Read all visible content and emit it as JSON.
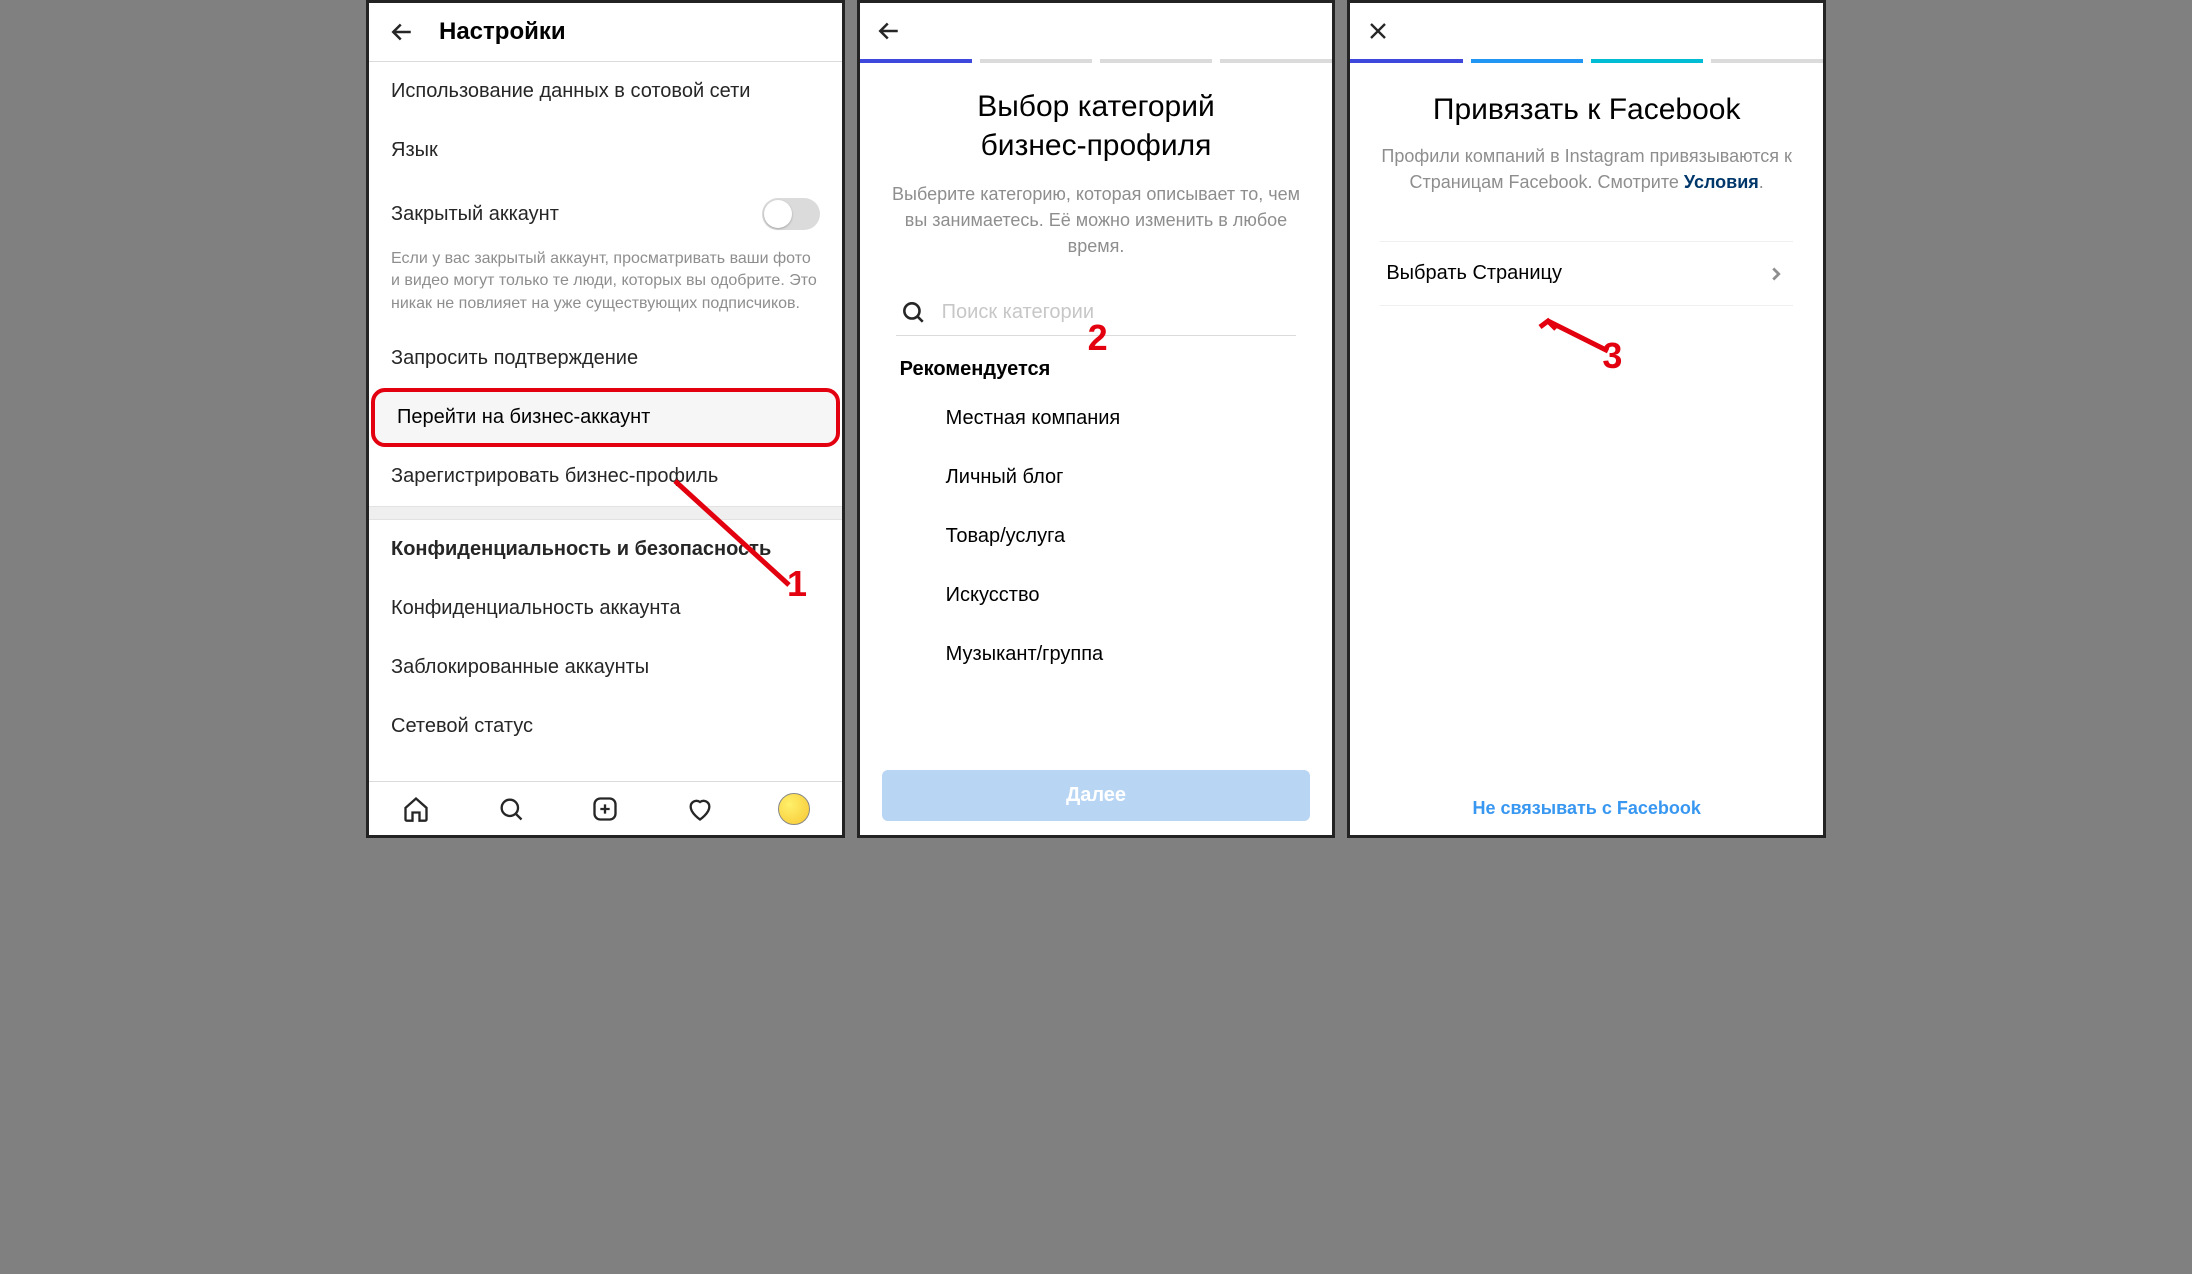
{
  "panel1": {
    "header_title": "Настройки",
    "items": {
      "data_usage": "Использование данных в сотовой сети",
      "language": "Язык",
      "private_account": "Закрытый аккаунт",
      "private_help": "Если у вас закрытый аккаунт, просматривать ваши фото и видео могут только те люди, которых вы одобрите. Это никак не повлияет на уже существующих подписчиков.",
      "request_verification": "Запросить подтверждение",
      "switch_business": "Перейти на бизнес-аккаунт",
      "register_business": "Зарегистрировать бизнес-профиль",
      "section_privacy": "Конфиденциальность и безопасность",
      "account_privacy": "Конфиденциальность аккаунта",
      "blocked_accounts": "Заблокированные аккаунты",
      "network_status": "Сетевой статус"
    }
  },
  "panel2": {
    "title_line1": "Выбор категорий",
    "title_line2": "бизнес-профиля",
    "subtitle": "Выберите категорию, которая описывает то, чем вы занимаетесь. Её можно изменить в любое время.",
    "search_placeholder": "Поиск категории",
    "recommended_header": "Рекомендуется",
    "categories": [
      "Местная компания",
      "Личный блог",
      "Товар/услуга",
      "Искусство",
      "Музыкант/группа"
    ],
    "next_button": "Далее"
  },
  "panel3": {
    "title": "Привязать к Facebook",
    "subtitle_plain": "Профили компаний в Instagram привязываются к Страницам Facebook. Смотрите ",
    "subtitle_link": "Условия",
    "subtitle_tail": ".",
    "choose_page": "Выбрать Страницу",
    "skip": "Не связывать с Facebook"
  },
  "annotations": {
    "n1": "1",
    "n2": "2",
    "n3": "3"
  }
}
